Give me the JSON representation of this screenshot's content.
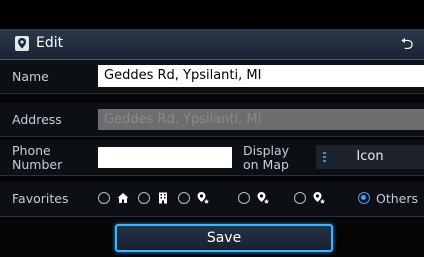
{
  "header": {
    "title": "Edit",
    "back_glyph": "⮌"
  },
  "form": {
    "name_label": "Name",
    "name_value": "Geddes Rd, Ypsilanti, MI",
    "address_label": "Address",
    "address_value": "Geddes Rd, Ypsilanti, MI",
    "phone_label_line1": "Phone",
    "phone_label_line2": "Number",
    "phone_value": "",
    "display_label_line1": "Display",
    "display_label_line2": "on Map",
    "icon_button_label": "Icon",
    "favorites_label": "Favorites",
    "favorites_options": [
      {
        "icon": "home-icon",
        "checked": false
      },
      {
        "icon": "building-icon",
        "checked": false
      },
      {
        "icon": "star-pin-1-icon",
        "checked": false
      },
      {
        "icon": "star-pin-2-icon",
        "checked": false
      },
      {
        "icon": "star-pin-3-icon",
        "checked": false
      }
    ],
    "others_label": "Others",
    "others_checked": true
  },
  "footer": {
    "save_label": "Save"
  },
  "colors": {
    "accent": "#3bb6ff",
    "radio_checked": "#3fa0ff",
    "header_bg": "#22303f"
  }
}
